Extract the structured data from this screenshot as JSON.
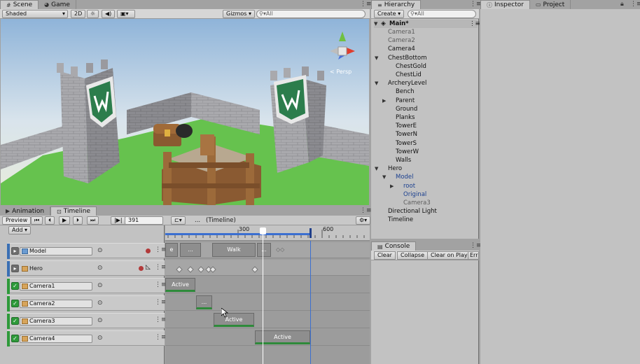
{
  "scene_panel": {
    "tabs": [
      {
        "label": "Scene",
        "icon": "grid-icon"
      },
      {
        "label": "Game",
        "icon": "pacman-icon"
      }
    ],
    "toolbar": {
      "draw_mode": "Shaded",
      "mode_2d": "2D",
      "gizmos": "Gizmos",
      "search_placeholder": "All"
    },
    "persp_label": "< Persp"
  },
  "timeline_panel": {
    "tabs": [
      {
        "label": "Animation",
        "icon": "animation-icon"
      },
      {
        "label": "Timeline",
        "icon": "timeline-icon"
      }
    ],
    "preview_label": "Preview",
    "frame_value": "391",
    "timeline_name": "(Timeline)",
    "ellipsis": "...",
    "add_label": "Add",
    "ruler": {
      "ticks": [
        "300",
        "600"
      ]
    },
    "tracks": [
      {
        "name": "Model",
        "type": "animation",
        "color": "#3a6fb4"
      },
      {
        "name": "Hero",
        "type": "animation",
        "color": "#3a6fb4"
      },
      {
        "name": "Camera1",
        "type": "activation",
        "color": "#2e9a3a"
      },
      {
        "name": "Camera2",
        "type": "activation",
        "color": "#2e9a3a"
      },
      {
        "name": "Camera3",
        "type": "activation",
        "color": "#2e9a3a"
      },
      {
        "name": "Camera4",
        "type": "activation",
        "color": "#2e9a3a"
      }
    ],
    "clips": {
      "model": [
        "e",
        "...",
        "Walk",
        "..."
      ],
      "camera1": "Active",
      "camera2": "...",
      "camera3": "Active",
      "camera4": "Active"
    }
  },
  "hierarchy": {
    "tab": "Hierarchy",
    "create_label": "Create",
    "search_placeholder": "All",
    "scene_name": "Main*",
    "items": [
      {
        "label": "Camera1",
        "indent": 1,
        "style": "gray"
      },
      {
        "label": "Camera2",
        "indent": 1,
        "style": "gray"
      },
      {
        "label": "Camera4",
        "indent": 1,
        "style": "normal"
      },
      {
        "label": "ChestBottom",
        "indent": 1,
        "style": "normal",
        "expanded": true
      },
      {
        "label": "ChestGold",
        "indent": 2,
        "style": "normal"
      },
      {
        "label": "ChestLid",
        "indent": 2,
        "style": "normal"
      },
      {
        "label": "ArcheryLevel",
        "indent": 1,
        "style": "normal",
        "expanded": true
      },
      {
        "label": "Bench",
        "indent": 2,
        "style": "normal"
      },
      {
        "label": "Parent",
        "indent": 2,
        "style": "normal",
        "collapsed": true
      },
      {
        "label": "Ground",
        "indent": 2,
        "style": "normal"
      },
      {
        "label": "Planks",
        "indent": 2,
        "style": "normal"
      },
      {
        "label": "TowerE",
        "indent": 2,
        "style": "normal"
      },
      {
        "label": "TowerN",
        "indent": 2,
        "style": "normal"
      },
      {
        "label": "TowerS",
        "indent": 2,
        "style": "normal"
      },
      {
        "label": "TowerW",
        "indent": 2,
        "style": "normal"
      },
      {
        "label": "Walls",
        "indent": 2,
        "style": "normal"
      },
      {
        "label": "Hero",
        "indent": 1,
        "style": "normal",
        "expanded": true
      },
      {
        "label": "Model",
        "indent": 2,
        "style": "blue",
        "expanded": true
      },
      {
        "label": "root",
        "indent": 3,
        "style": "blue",
        "collapsed": true
      },
      {
        "label": "Original",
        "indent": 3,
        "style": "blue"
      },
      {
        "label": "Camera3",
        "indent": 3,
        "style": "gray"
      },
      {
        "label": "Directional Light",
        "indent": 1,
        "style": "normal"
      },
      {
        "label": "Timeline",
        "indent": 1,
        "style": "normal"
      }
    ]
  },
  "console": {
    "tab": "Console",
    "buttons": [
      "Clear",
      "Collapse",
      "Clear on Play",
      "Err"
    ]
  },
  "inspector": {
    "tabs": [
      {
        "label": "Inspector",
        "icon": "info-icon"
      },
      {
        "label": "Project",
        "icon": "folder-icon"
      }
    ]
  }
}
